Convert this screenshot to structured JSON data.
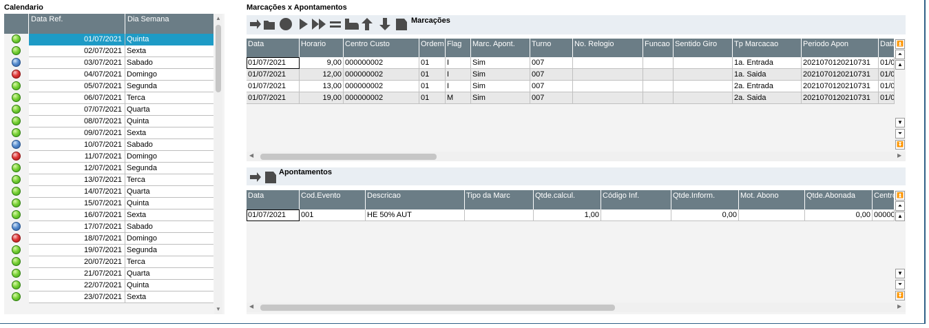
{
  "calendar": {
    "title": "Calendario",
    "columns": [
      "",
      "Data Ref.",
      "Dia Semana"
    ],
    "rows": [
      {
        "status": "green",
        "date": "01/07/2021",
        "day": "Quinta",
        "selected": true
      },
      {
        "status": "green",
        "date": "02/07/2021",
        "day": "Sexta"
      },
      {
        "status": "blue",
        "date": "03/07/2021",
        "day": "Sabado"
      },
      {
        "status": "red",
        "date": "04/07/2021",
        "day": "Domingo"
      },
      {
        "status": "green",
        "date": "05/07/2021",
        "day": "Segunda"
      },
      {
        "status": "green",
        "date": "06/07/2021",
        "day": "Terca"
      },
      {
        "status": "green",
        "date": "07/07/2021",
        "day": "Quarta"
      },
      {
        "status": "green",
        "date": "08/07/2021",
        "day": "Quinta"
      },
      {
        "status": "green",
        "date": "09/07/2021",
        "day": "Sexta"
      },
      {
        "status": "blue",
        "date": "10/07/2021",
        "day": "Sabado"
      },
      {
        "status": "red",
        "date": "11/07/2021",
        "day": "Domingo"
      },
      {
        "status": "green",
        "date": "12/07/2021",
        "day": "Segunda"
      },
      {
        "status": "green",
        "date": "13/07/2021",
        "day": "Terca"
      },
      {
        "status": "green",
        "date": "14/07/2021",
        "day": "Quarta"
      },
      {
        "status": "green",
        "date": "15/07/2021",
        "day": "Quinta"
      },
      {
        "status": "green",
        "date": "16/07/2021",
        "day": "Sexta"
      },
      {
        "status": "blue",
        "date": "17/07/2021",
        "day": "Sabado"
      },
      {
        "status": "red",
        "date": "18/07/2021",
        "day": "Domingo"
      },
      {
        "status": "green",
        "date": "19/07/2021",
        "day": "Segunda"
      },
      {
        "status": "green",
        "date": "20/07/2021",
        "day": "Terca"
      },
      {
        "status": "green",
        "date": "21/07/2021",
        "day": "Quarta"
      },
      {
        "status": "green",
        "date": "22/07/2021",
        "day": "Quinta"
      },
      {
        "status": "green",
        "date": "23/07/2021",
        "day": "Sexta"
      }
    ]
  },
  "main": {
    "title": "Marcações x Apontamentos"
  },
  "marcacoes": {
    "label": "Marcações",
    "toolbar_icons": [
      "arrow-right-icon",
      "folder-icon",
      "circle-icon",
      "play-icon",
      "fast-forward-icon",
      "equals-icon",
      "thumb-icon",
      "arrow-up-icon",
      "arrow-down-icon",
      "tag-icon"
    ],
    "columns": [
      "Data",
      "Horario",
      "Centro Custo",
      "Ordem",
      "Flag",
      "Marc. Apont.",
      "Turno",
      "No. Relogio",
      "Funcao",
      "Sentido Giro",
      "Tp Marcacao",
      "Periodo Apon",
      "Data"
    ],
    "rows": [
      [
        "01/07/2021",
        "9,00",
        "000000002",
        "01",
        "I",
        "Sim",
        "007",
        "",
        "",
        "",
        "1a. Entrada",
        "2021070120210731",
        "01/0"
      ],
      [
        "01/07/2021",
        "12,00",
        "000000002",
        "01",
        "I",
        "Sim",
        "007",
        "",
        "",
        "",
        "1a. Saida",
        "2021070120210731",
        "01/0"
      ],
      [
        "01/07/2021",
        "13,00",
        "000000002",
        "01",
        "I",
        "Sim",
        "007",
        "",
        "",
        "",
        "2a. Entrada",
        "2021070120210731",
        "01/0"
      ],
      [
        "01/07/2021",
        "19,00",
        "000000002",
        "01",
        "M",
        "Sim",
        "007",
        "",
        "",
        "",
        "2a. Saida",
        "2021070120210731",
        "01/0"
      ]
    ]
  },
  "apontamentos": {
    "label": "Apontamentos",
    "toolbar_icons": [
      "arrow-right-icon",
      "tag-icon"
    ],
    "columns": [
      "Data",
      "Cod.Evento",
      "Descricao",
      "Tipo da Marc",
      "Qtde.calcul.",
      "Código Inf.",
      "Qtde.Inform.",
      "Mot. Abono",
      "Qtde.Abonada",
      "Centro"
    ],
    "rows": [
      [
        "01/07/2021",
        "001",
        "HE 50% AUT",
        "",
        "1,00",
        "",
        "0,00",
        "",
        "0,00",
        "00000"
      ]
    ]
  },
  "colors": {
    "header_bg": "#6b7d86",
    "selected_row": "#1e9bc6",
    "toolbar_bg": "#e9eef3",
    "frame": "#2e5f86"
  }
}
